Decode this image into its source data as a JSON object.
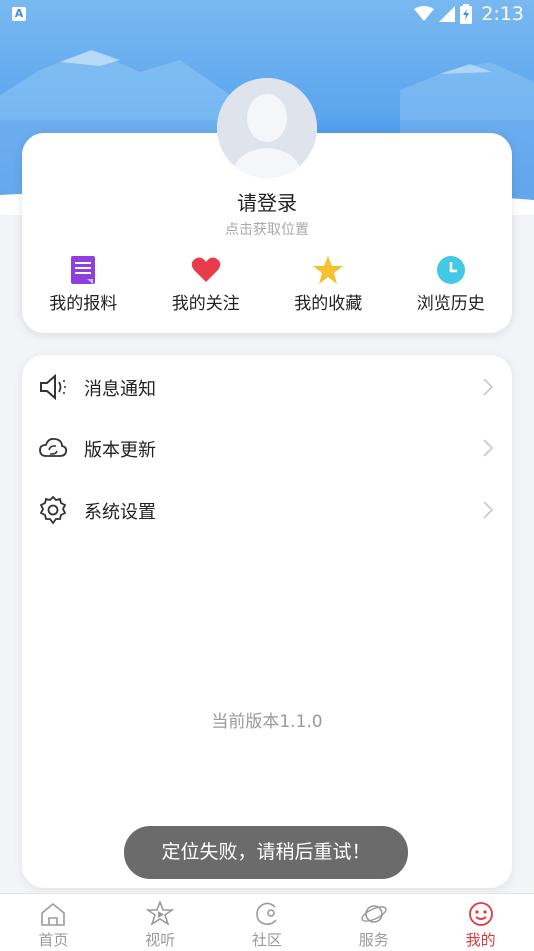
{
  "status_bar": {
    "time": "2:13",
    "app_badge": "A"
  },
  "profile": {
    "login_prompt": "请登录",
    "location_hint": "点击获取位置"
  },
  "quick_actions": [
    {
      "label": "我的报料",
      "icon": "document-icon",
      "color": "#8e3fe0"
    },
    {
      "label": "我的关注",
      "icon": "heart-icon",
      "color": "#ea3b4a"
    },
    {
      "label": "我的收藏",
      "icon": "star-icon",
      "color": "#f2c230"
    },
    {
      "label": "浏览历史",
      "icon": "clock-icon",
      "color": "#43c8e6"
    }
  ],
  "menu": [
    {
      "label": "消息通知",
      "icon": "speaker-icon"
    },
    {
      "label": "版本更新",
      "icon": "cloud-sync-icon"
    },
    {
      "label": "系统设置",
      "icon": "gear-icon"
    }
  ],
  "version_text": "当前版本1.1.0",
  "toast": "定位失败，请稍后重试！",
  "tabs": [
    {
      "label": "首页",
      "icon": "home-icon",
      "active": false
    },
    {
      "label": "视听",
      "icon": "play-video-icon",
      "active": false
    },
    {
      "label": "社区",
      "icon": "community-icon",
      "active": false
    },
    {
      "label": "服务",
      "icon": "planet-icon",
      "active": false
    },
    {
      "label": "我的",
      "icon": "smiley-icon",
      "active": true
    }
  ],
  "colors": {
    "header_blue": "#4f9ae9",
    "active_tab": "#e0383d",
    "toast_bg": "#6b6b6b"
  }
}
